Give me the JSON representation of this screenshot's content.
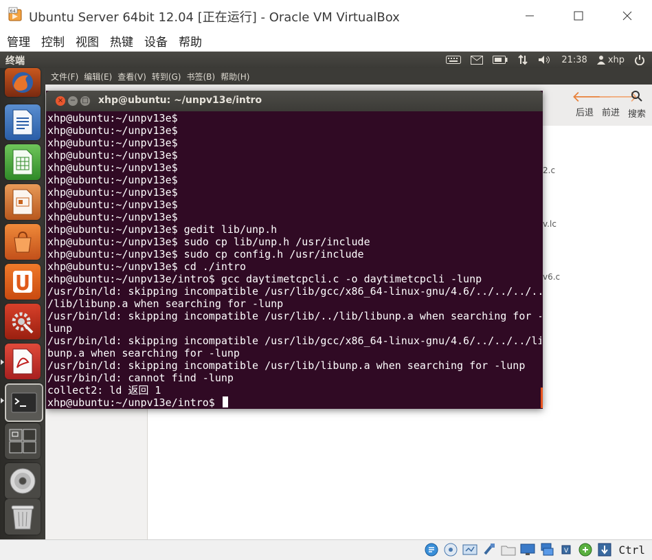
{
  "host_window": {
    "title": "Ubuntu Server 64bit 12.04 [正在运行] - Oracle VM VirtualBox",
    "logo_badge": "64",
    "menus": [
      "管理",
      "控制",
      "视图",
      "热键",
      "设备",
      "帮助"
    ]
  },
  "ubuntu_panel": {
    "app_name": "终端",
    "clock": "21:38",
    "user": "xhp"
  },
  "launcher": {
    "items": [
      {
        "name": "firefox-icon"
      },
      {
        "name": "libreoffice-writer-icon"
      },
      {
        "name": "libreoffice-calc-icon"
      },
      {
        "name": "libreoffice-impress-icon"
      },
      {
        "name": "software-center-icon"
      },
      {
        "name": "ubuntu-one-icon"
      },
      {
        "name": "system-settings-icon"
      },
      {
        "name": "document-viewer-icon"
      },
      {
        "name": "terminal-icon"
      },
      {
        "name": "workspace-switcher-icon"
      },
      {
        "name": "cd-drive-icon"
      },
      {
        "name": "trash-icon"
      }
    ]
  },
  "nautilus": {
    "menus": [
      "文件(F)",
      "编辑(E)",
      "查看(V)",
      "转到(G)",
      "书签(B)",
      "帮助(H)"
    ],
    "back_label": "后退",
    "forward_label": "前进",
    "search_label": "搜索",
    "file_fragments": [
      "2.c",
      "v.lc",
      "v6.c"
    ]
  },
  "terminal": {
    "title": "xhp@ubuntu: ~/unpv13e/intro",
    "lines": [
      "xhp@ubuntu:~/unpv13e$",
      "xhp@ubuntu:~/unpv13e$",
      "xhp@ubuntu:~/unpv13e$",
      "xhp@ubuntu:~/unpv13e$",
      "xhp@ubuntu:~/unpv13e$",
      "xhp@ubuntu:~/unpv13e$",
      "xhp@ubuntu:~/unpv13e$",
      "xhp@ubuntu:~/unpv13e$",
      "xhp@ubuntu:~/unpv13e$",
      "xhp@ubuntu:~/unpv13e$ gedit lib/unp.h",
      "xhp@ubuntu:~/unpv13e$ sudo cp lib/unp.h /usr/include",
      "xhp@ubuntu:~/unpv13e$ sudo cp config.h /usr/include",
      "xhp@ubuntu:~/unpv13e$ cd ./intro",
      "xhp@ubuntu:~/unpv13e/intro$ gcc daytimetcpcli.c -o daytimetcpcli -lunp",
      "/usr/bin/ld: skipping incompatible /usr/lib/gcc/x86_64-linux-gnu/4.6/../../../..",
      "/lib/libunp.a when searching for -lunp",
      "/usr/bin/ld: skipping incompatible /usr/lib/../lib/libunp.a when searching for -",
      "lunp",
      "/usr/bin/ld: skipping incompatible /usr/lib/gcc/x86_64-linux-gnu/4.6/../../../li",
      "bunp.a when searching for -lunp",
      "/usr/bin/ld: skipping incompatible /usr/lib/libunp.a when searching for -lunp",
      "/usr/bin/ld: cannot find -lunp",
      "collect2: ld 返回 1"
    ],
    "prompt": "xhp@ubuntu:~/unpv13e/intro$ "
  },
  "statusbar": {
    "host_key": "Ctrl"
  }
}
